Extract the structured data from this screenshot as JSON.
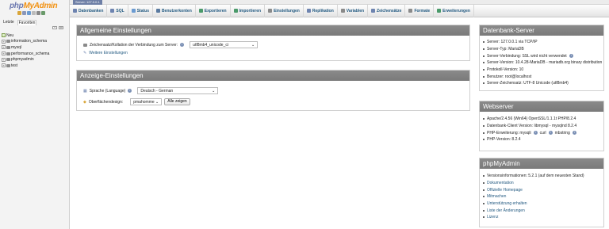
{
  "brand": {
    "php": "php",
    "myadmin": "MyAdmin"
  },
  "serverbar": {
    "label": "Server: 127.0.0.1"
  },
  "sidebar": {
    "tabs": [
      "Letzte",
      "Favoriten"
    ],
    "databases": [
      {
        "name": "Neu",
        "icon": "new-icon"
      },
      {
        "name": "information_schema",
        "icon": "database-icon"
      },
      {
        "name": "mysql",
        "icon": "database-icon"
      },
      {
        "name": "performance_schema",
        "icon": "database-icon"
      },
      {
        "name": "phpmyadmin",
        "icon": "database-icon"
      },
      {
        "name": "test",
        "icon": "database-icon"
      }
    ]
  },
  "menu": [
    {
      "label": "Datenbanken",
      "icon": "databases-icon",
      "color": "#6e84b0"
    },
    {
      "label": "SQL",
      "icon": "sql-icon",
      "color": "#6e84b0"
    },
    {
      "label": "Status",
      "icon": "status-icon",
      "color": "#6b9bd1"
    },
    {
      "label": "Benutzerkonten",
      "icon": "users-icon",
      "color": "#5a7aa0"
    },
    {
      "label": "Exportieren",
      "icon": "export-icon",
      "color": "#4a9a6a"
    },
    {
      "label": "Importieren",
      "icon": "import-icon",
      "color": "#4a9a6a"
    },
    {
      "label": "Einstellungen",
      "icon": "settings-icon",
      "color": "#8a8a8a"
    },
    {
      "label": "Replikation",
      "icon": "replication-icon",
      "color": "#6e84b0"
    },
    {
      "label": "Variablen",
      "icon": "variables-icon",
      "color": "#8a8a8a"
    },
    {
      "label": "Zeichensätze",
      "icon": "charsets-icon",
      "color": "#6e84b0"
    },
    {
      "label": "Formate",
      "icon": "engines-icon",
      "color": "#8a8a8a"
    },
    {
      "label": "Erweiterungen",
      "icon": "plugins-icon",
      "color": "#4a9a6a"
    }
  ],
  "general": {
    "title": "Allgemeine Einstellungen",
    "collation_label": "Zeichensatz/Kollation der Verbindung zum Server:",
    "collation_value": "utf8mb4_unicode_ci",
    "more_settings": "Weitere Einstellungen"
  },
  "appearance": {
    "title": "Anzeige-Einstellungen",
    "language_label": "Sprache (Language)",
    "language_value": "Deutsch - German",
    "theme_label": "Oberflächendesign:",
    "theme_value": "pmahomme",
    "show_all": "Alle zeigen"
  },
  "dbserver": {
    "title": "Datenbank-Server",
    "items": [
      "Server: 127.0.0.1 via TCP/IP",
      "Server-Typ: MariaDB",
      "Server-Verbindung: SSL wird nicht verwendet",
      "Server-Version: 10.4.28-MariaDB - mariadb.org binary distribution",
      "Protokoll-Version: 10",
      "Benutzer: root@localhost",
      "Server-Zeichensatz: UTF-8 Unicode (utf8mb4)"
    ]
  },
  "webserver": {
    "title": "Webserver",
    "items": [
      "Apache/2.4.56 (Win64) OpenSSL/1.1.1t PHP/8.2.4",
      "Datenbank-Client Version: libmysql - mysqlnd 8.2.4",
      "PHP-Erweiterung: mysqli",
      "PHP-Version: 8.2.4"
    ],
    "ext_curl": "curl",
    "ext_mbstring": "mbstring"
  },
  "pma": {
    "title": "phpMyAdmin",
    "version": "Versionsinformationen: 5.2.1 (auf dem neuesten Stand)",
    "links": [
      "Dokumentation",
      "Offizielle Homepage",
      "Mitmachen",
      "Unterstützung erhalten",
      "Liste der Änderungen",
      "Lizenz"
    ]
  }
}
